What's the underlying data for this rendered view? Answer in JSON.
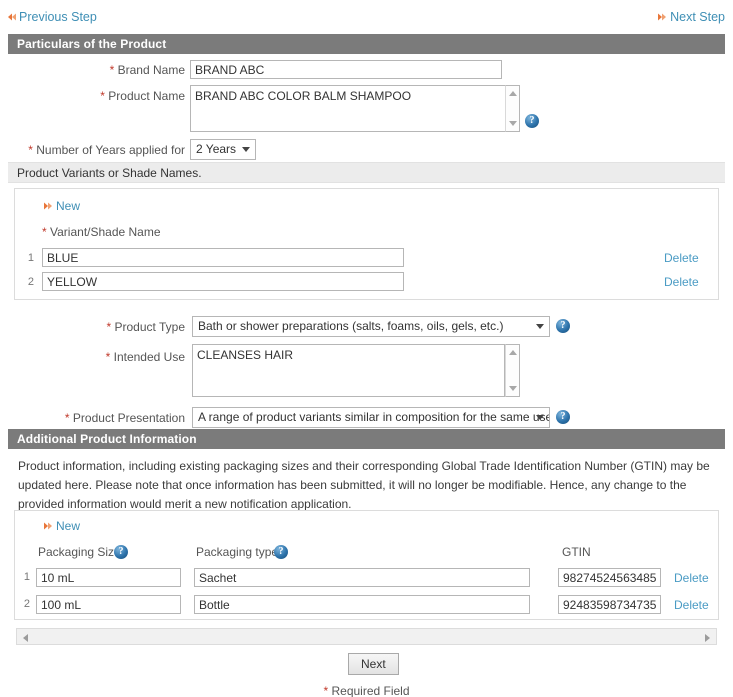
{
  "nav": {
    "previous_label": "Previous Step",
    "previous_icon": "arrow-left-icon",
    "next_label": "Next Step",
    "next_icon": "arrow-right-icon"
  },
  "sections": {
    "particulars": {
      "title": "Particulars of the Product",
      "fields": {
        "brand_name": {
          "label": "Brand Name",
          "required": true,
          "value": "BRAND ABC",
          "placeholder": ""
        },
        "product_name": {
          "label": "Product Name",
          "required": true,
          "value": "BRAND ABC COLOR BALM SHAMPOO",
          "placeholder": "",
          "help_icon": "help-icon"
        },
        "number_of_years": {
          "label": "Number of Years applied for",
          "required": true,
          "value": "2 Years"
        }
      }
    },
    "variants": {
      "title": "Product Variants or Shade Names.",
      "new_label": "New",
      "column_header": "Variant/Shade Name",
      "column_header_required": true,
      "delete_label": "Delete",
      "rows": [
        {
          "index": "1",
          "value": "BLUE",
          "delete_label": "Delete"
        },
        {
          "index": "2",
          "value": "YELLOW",
          "delete_label": "Delete"
        }
      ]
    },
    "classification": {
      "product_type": {
        "label": "Product Type",
        "required": true,
        "value": "Bath or shower preparations (salts, foams, oils, gels, etc.)",
        "help_icon": "help-icon"
      },
      "intended_use": {
        "label": "Intended Use",
        "required": true,
        "value": "CLEANSES HAIR",
        "placeholder": ""
      },
      "product_presentation": {
        "label": "Product Presentation",
        "required": true,
        "value": "A range of product variants similar in composition for the same use but",
        "help_icon": "help-icon"
      }
    },
    "additional": {
      "title": "Additional Product Information",
      "description": "Product information, including existing packaging sizes and their corresponding Global Trade Identification Number (GTIN) may be updated here. Please note that once information has been submitted, it will no longer be modifiable. Hence, any change to the provided information would merit a new notification application.",
      "new_label": "New",
      "columns": {
        "packaging_size": "Packaging Size",
        "packaging_type": "Packaging type",
        "gtin": "GTIN"
      },
      "rows": [
        {
          "index": "1",
          "packaging_size": "10 mL",
          "packaging_type": "Sachet",
          "gtin": "98274524563485",
          "delete_label": "Delete"
        },
        {
          "index": "2",
          "packaging_size": "100 mL",
          "packaging_type": "Bottle",
          "gtin": "92483598734735",
          "delete_label": "Delete"
        }
      ]
    }
  },
  "footer": {
    "next_button": "Next",
    "required_note": "* Required Field",
    "required_marker": "*"
  },
  "colors": {
    "section_header_bg": "#7b7b7b",
    "link": "#3f8fb5",
    "required_asterisk": "#c0392b",
    "arrow_icon": "#e8763a",
    "help_icon": "#2e74ac"
  }
}
